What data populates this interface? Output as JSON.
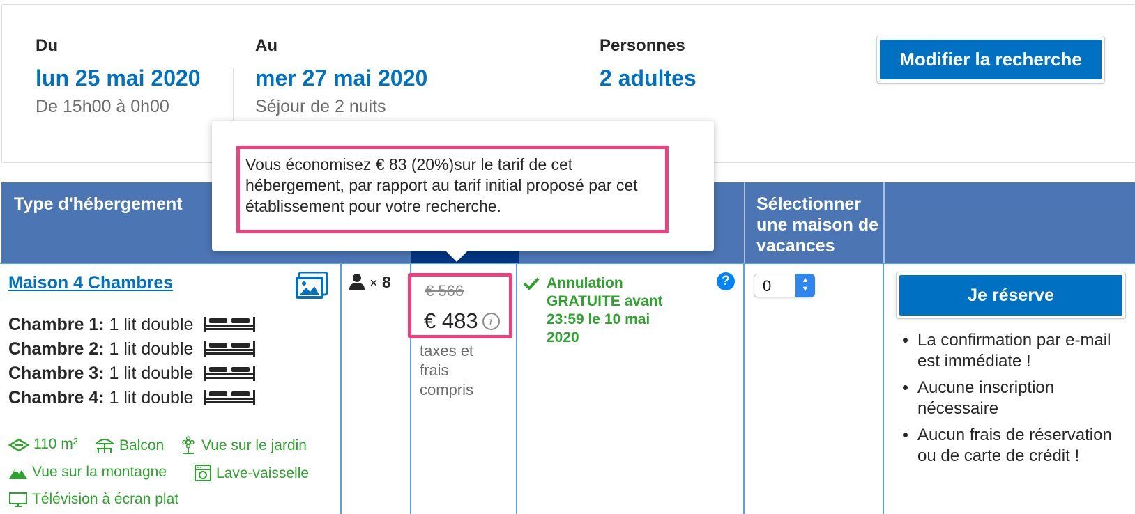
{
  "search": {
    "from": {
      "label": "Du",
      "date": "lun 25 mai 2020",
      "detail": "De 15h00 à 0h00"
    },
    "to": {
      "label": "Au",
      "date": "mer 27 mai 2020",
      "detail": "Séjour de 2 nuits"
    },
    "guests": {
      "label": "Personnes",
      "value": "2 adultes"
    },
    "modify_button": "Modifier la recherche"
  },
  "table": {
    "headers": {
      "type": "Type d'hébergement",
      "select": "Sélectionner une maison de vacances"
    }
  },
  "room": {
    "name": "Maison 4 Chambres",
    "beds": [
      {
        "label": "Chambre 1:",
        "value": "1 lit double"
      },
      {
        "label": "Chambre 2:",
        "value": "1 lit double"
      },
      {
        "label": "Chambre 3:",
        "value": "1 lit double"
      },
      {
        "label": "Chambre 4:",
        "value": "1 lit double"
      }
    ],
    "facilities": {
      "area": "110 m²",
      "balcony": "Balcon",
      "garden_view": "Vue sur le jardin",
      "mountain_view": "Vue sur la montagne",
      "dishwasher": "Lave-vaisselle",
      "tv": "Télévision à écran plat"
    },
    "capacity": {
      "times": "×",
      "count": "8"
    },
    "price": {
      "original": "€ 566",
      "current": "€ 483",
      "note_line1": "taxes et",
      "note_line2": "frais",
      "note_line3": "compris"
    },
    "cancellation": {
      "line1": "Annulation",
      "line2": "GRATUITE avant",
      "line3": "23:59 le 10 mai",
      "line4": "2020"
    },
    "quantity": {
      "selected": "0"
    },
    "reserve_button": "Je réserve",
    "perks": [
      "La confirmation par e-mail est immédiate !",
      "Aucune inscription nécessaire",
      "Aucun frais de réservation ou de carte de crédit !"
    ]
  },
  "tooltip": {
    "text": "Vous économisez € 83 (20%)sur le tarif de cet hébergement, par rapport au tarif initial proposé par cet établissement pour votre recherche."
  },
  "colors": {
    "brand_blue": "#0071c2",
    "header_blue": "#4b75b3",
    "header_dark": "#003580",
    "grid_blue": "#5aa0e6",
    "green": "#2ea32e",
    "highlight_pink": "#f0417f"
  },
  "icons": {
    "gallery": "gallery-icon",
    "bed": "bed-icon",
    "person": "person-icon",
    "check": "check-icon",
    "help": "help-icon",
    "info": "info-icon"
  }
}
